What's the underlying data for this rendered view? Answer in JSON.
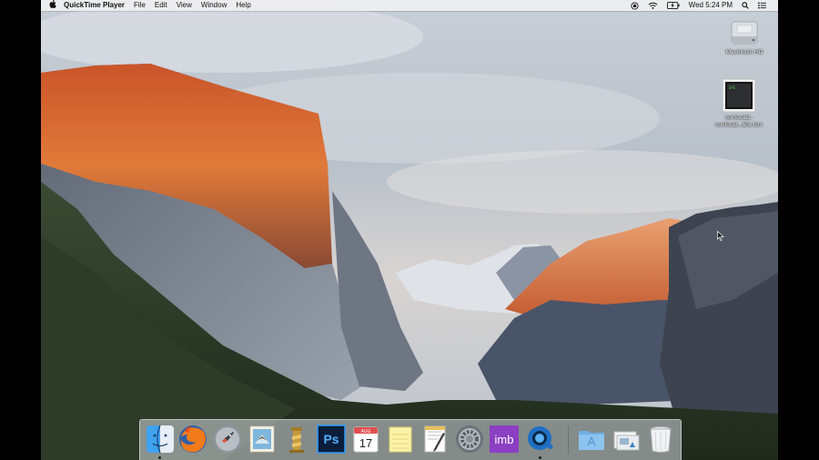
{
  "menubar": {
    "app_name": "QuickTime Player",
    "menus": [
      "File",
      "Edit",
      "View",
      "Window",
      "Help"
    ],
    "clock": "Wed 5:24 PM"
  },
  "desktop": {
    "icons": [
      {
        "label": "Macintosh HD"
      },
      {
        "label_line1": "confocal1-",
        "label_line2": "confocal...60x.lsm"
      }
    ]
  },
  "dock": {
    "items": [
      "Finder",
      "Firefox",
      "Launchpad",
      "Mail",
      "Script Editor",
      "Photoshop",
      "Calendar",
      "Notes",
      "TextEdit",
      "System Preferences",
      "imb",
      "QuickTime Player",
      "Applications",
      "Downloads",
      "Trash"
    ],
    "calendar_month": "AUG",
    "calendar_day": "17",
    "photoshop_label": "Ps",
    "imb_label": "imb"
  },
  "colors": {
    "menubar": "#eeeef0",
    "imb": "#8b3fc3",
    "photoshop": "#0b1d3a"
  }
}
